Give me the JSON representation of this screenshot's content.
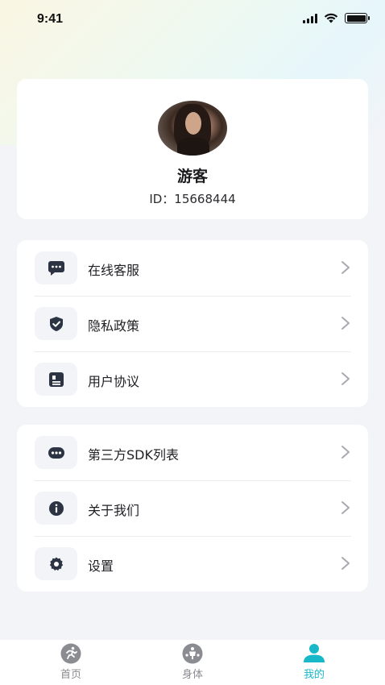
{
  "status_bar": {
    "time": "9:41"
  },
  "profile": {
    "nickname": "游客",
    "id_text": "ID：15668444"
  },
  "menu_group_1": [
    {
      "label": "在线客服",
      "icon": "chat-bubble-icon"
    },
    {
      "label": "隐私政策",
      "icon": "shield-check-icon"
    },
    {
      "label": "用户协议",
      "icon": "document-icon"
    }
  ],
  "menu_group_2": [
    {
      "label": "第三方SDK列表",
      "icon": "ellipsis-icon"
    },
    {
      "label": "关于我们",
      "icon": "info-icon"
    },
    {
      "label": "设置",
      "icon": "gear-icon"
    }
  ],
  "tabbar": {
    "tabs": [
      {
        "label": "首页",
        "icon": "running-person-icon",
        "active": false
      },
      {
        "label": "身体",
        "icon": "body-icon",
        "active": false
      },
      {
        "label": "我的",
        "icon": "user-icon",
        "active": true
      }
    ]
  },
  "colors": {
    "accent": "#19b8c8",
    "icon_dark": "#2c3444",
    "inactive_tab": "#8b8b92"
  }
}
